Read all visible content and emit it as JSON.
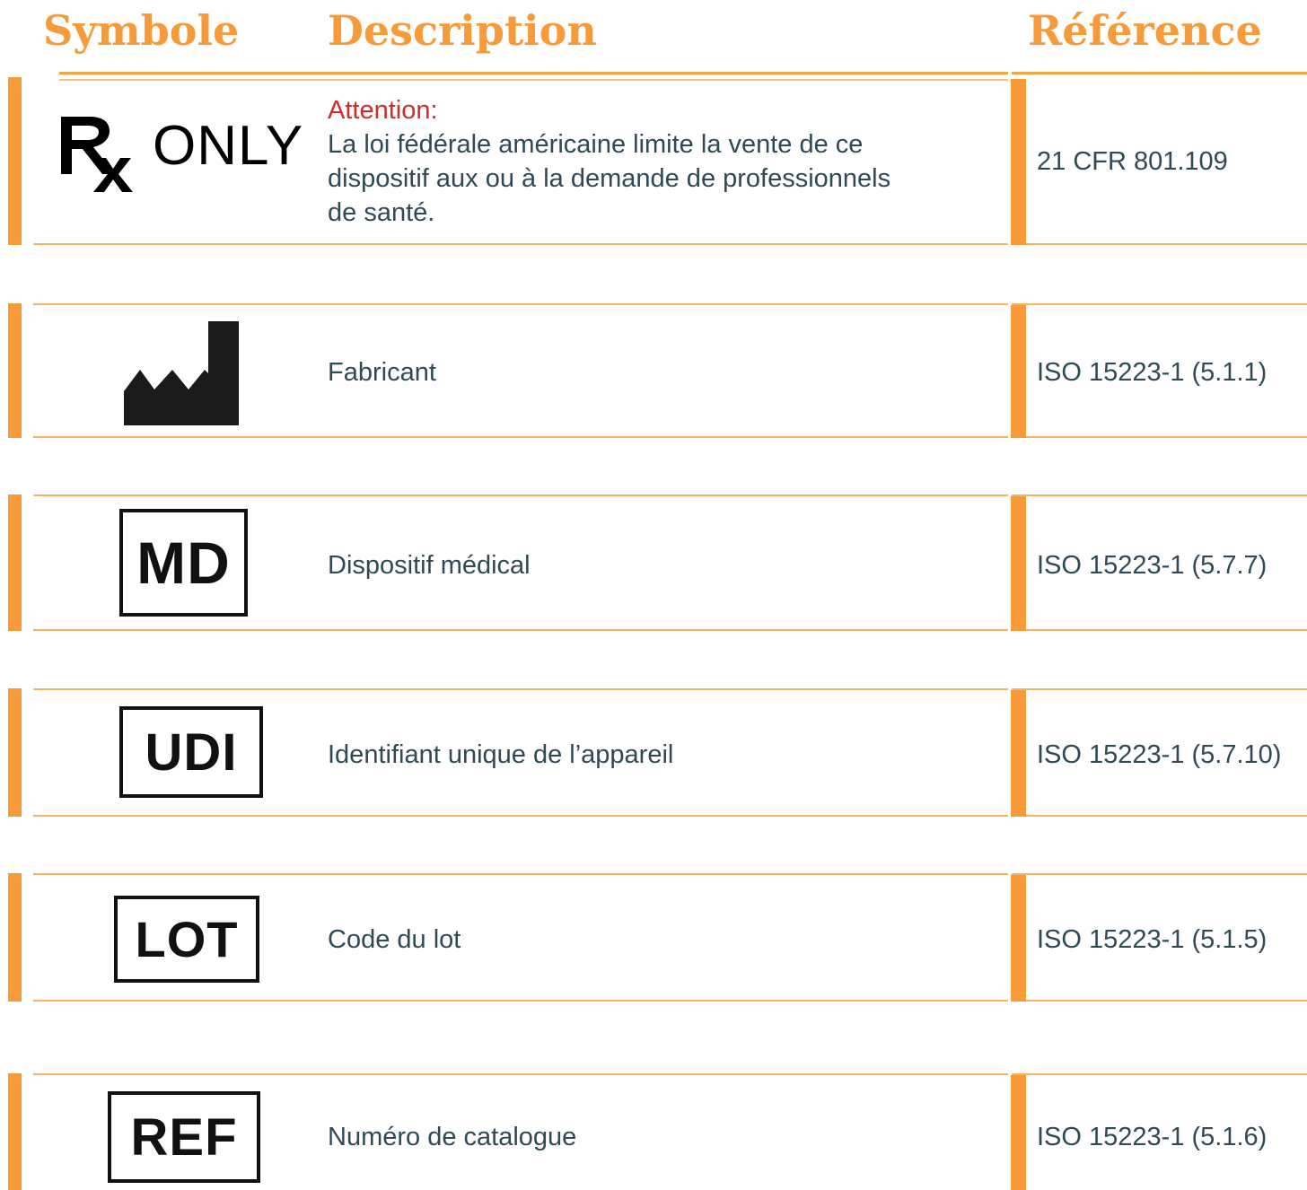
{
  "headers": {
    "symbol": "Symbole",
    "description": "Description",
    "reference": "Référence"
  },
  "colors": {
    "accent": "#F79B3A",
    "text": "#2F4A55",
    "warning": "#D12B2B",
    "symbol": "#111111"
  },
  "rows": [
    {
      "symbol": "rx-only-icon",
      "symbol_text": "ONLY",
      "warning": "Attention:",
      "description_lines": [
        "La loi fédérale américaine limite la vente de ce",
        "dispositif aux ou à la demande de professionnels",
        "de santé."
      ],
      "reference": "21 CFR 801.109"
    },
    {
      "symbol": "manufacturer-icon",
      "description": "Fabricant",
      "reference": "ISO 15223-1 (5.1.1)"
    },
    {
      "symbol": "md-icon",
      "symbol_text": "MD",
      "description": "Dispositif médical",
      "reference": "ISO 15223-1 (5.7.7)"
    },
    {
      "symbol": "udi-icon",
      "symbol_text": "UDI",
      "description": "Identifiant unique de l’appareil",
      "reference": "ISO 15223-1 (5.7.10)"
    },
    {
      "symbol": "lot-icon",
      "symbol_text": "LOT",
      "description": "Code du lot",
      "reference": "ISO 15223-1 (5.1.5)"
    },
    {
      "symbol": "ref-icon",
      "symbol_text": "REF",
      "description": "Numéro de catalogue",
      "reference": "ISO 15223-1 (5.1.6)"
    }
  ]
}
